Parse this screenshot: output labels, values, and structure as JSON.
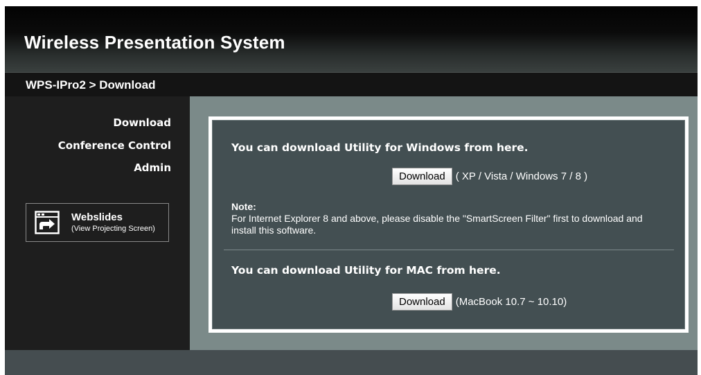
{
  "header": {
    "title": "Wireless Presentation System"
  },
  "breadcrumb": "WPS-IPro2 > Download",
  "sidebar": {
    "items": [
      {
        "label": "Download"
      },
      {
        "label": "Conference Control"
      },
      {
        "label": "Admin"
      }
    ],
    "webslides": {
      "title": "Webslides",
      "subtitle": "(View Projecting Screen)",
      "icon": "presentation-screen-icon"
    }
  },
  "main": {
    "windows": {
      "heading": "You can download Utility for Windows from here.",
      "button_label": "Download",
      "compat": "( XP / Vista / Windows 7 / 8 )"
    },
    "note": {
      "label": "Note:",
      "text": "For Internet Explorer 8 and above, please disable the \"SmartScreen Filter\" first to download and install this software."
    },
    "mac": {
      "heading": "You can download Utility for MAC from here.",
      "button_label": "Download",
      "compat": "(MacBook 10.7 ~ 10.10)"
    }
  },
  "colors": {
    "header_bg": "#0b0b0b",
    "content_bg": "#7b8a89",
    "panel_bg": "#434f52",
    "footer_bg": "#454d50"
  }
}
